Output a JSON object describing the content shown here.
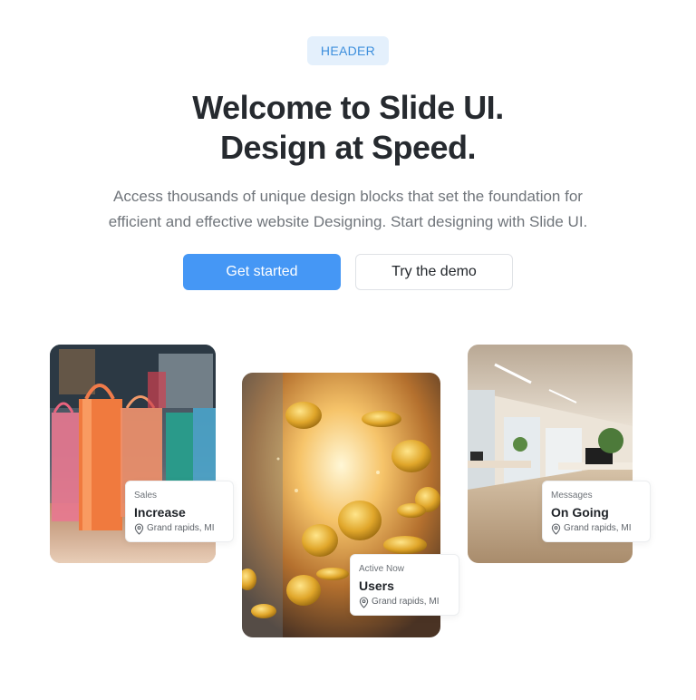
{
  "hero": {
    "badge": "HEADER",
    "title_line1": "Welcome to Slide UI.",
    "title_line2": "Design at Speed.",
    "subtitle_line1": "Access thousands of unique design blocks that set the foundation for",
    "subtitle_line2": "efficient and effective website Designing. Start designing with Slide UI.",
    "primary_button": "Get started",
    "secondary_button": "Try the demo"
  },
  "colors": {
    "accent": "#4597f5",
    "badge_bg": "#e4f0fc",
    "badge_text": "#3d8fdd"
  },
  "cards": [
    {
      "label": "Sales",
      "value": "Increase",
      "location": "Grand rapids, MI",
      "icon": "location-pin-icon"
    },
    {
      "label": "Active Now",
      "value": "Users",
      "location": "Grand rapids, MI",
      "icon": "location-pin-icon"
    },
    {
      "label": "Messages",
      "value": "On Going",
      "location": "Grand rapids, MI",
      "icon": "location-pin-icon"
    }
  ]
}
